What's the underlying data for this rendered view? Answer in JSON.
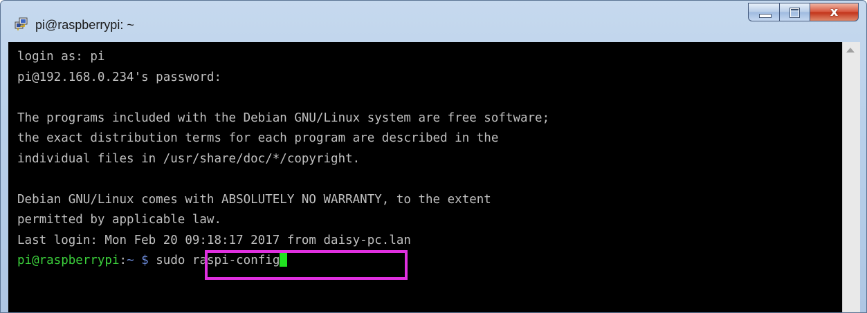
{
  "window": {
    "title": "pi@raspberrypi: ~",
    "icon": "putty-icon",
    "controls": {
      "minimize": "minimize-icon",
      "maximize": "maximize-icon",
      "close_label": "x"
    }
  },
  "terminal": {
    "lines": [
      "login as: pi",
      "pi@192.168.0.234's password:",
      "",
      "The programs included with the Debian GNU/Linux system are free software;",
      "the exact distribution terms for each program are described in the",
      "individual files in /usr/share/doc/*/copyright.",
      "",
      "Debian GNU/Linux comes with ABSOLUTELY NO WARRANTY, to the extent",
      "permitted by applicable law.",
      "Last login: Mon Feb 20 09:18:17 2017 from daisy-pc.lan"
    ],
    "prompt": {
      "user_host": "pi@raspberrypi",
      "separator": ":",
      "path": "~",
      "dollar": "$",
      "command": "sudo raspi-config"
    }
  },
  "colors": {
    "background": "#000000",
    "text": "#c0c0c0",
    "prompt_user": "#3cd23c",
    "prompt_path": "#6f8fe0",
    "cursor": "#21e221",
    "highlight": "#e030e0"
  }
}
